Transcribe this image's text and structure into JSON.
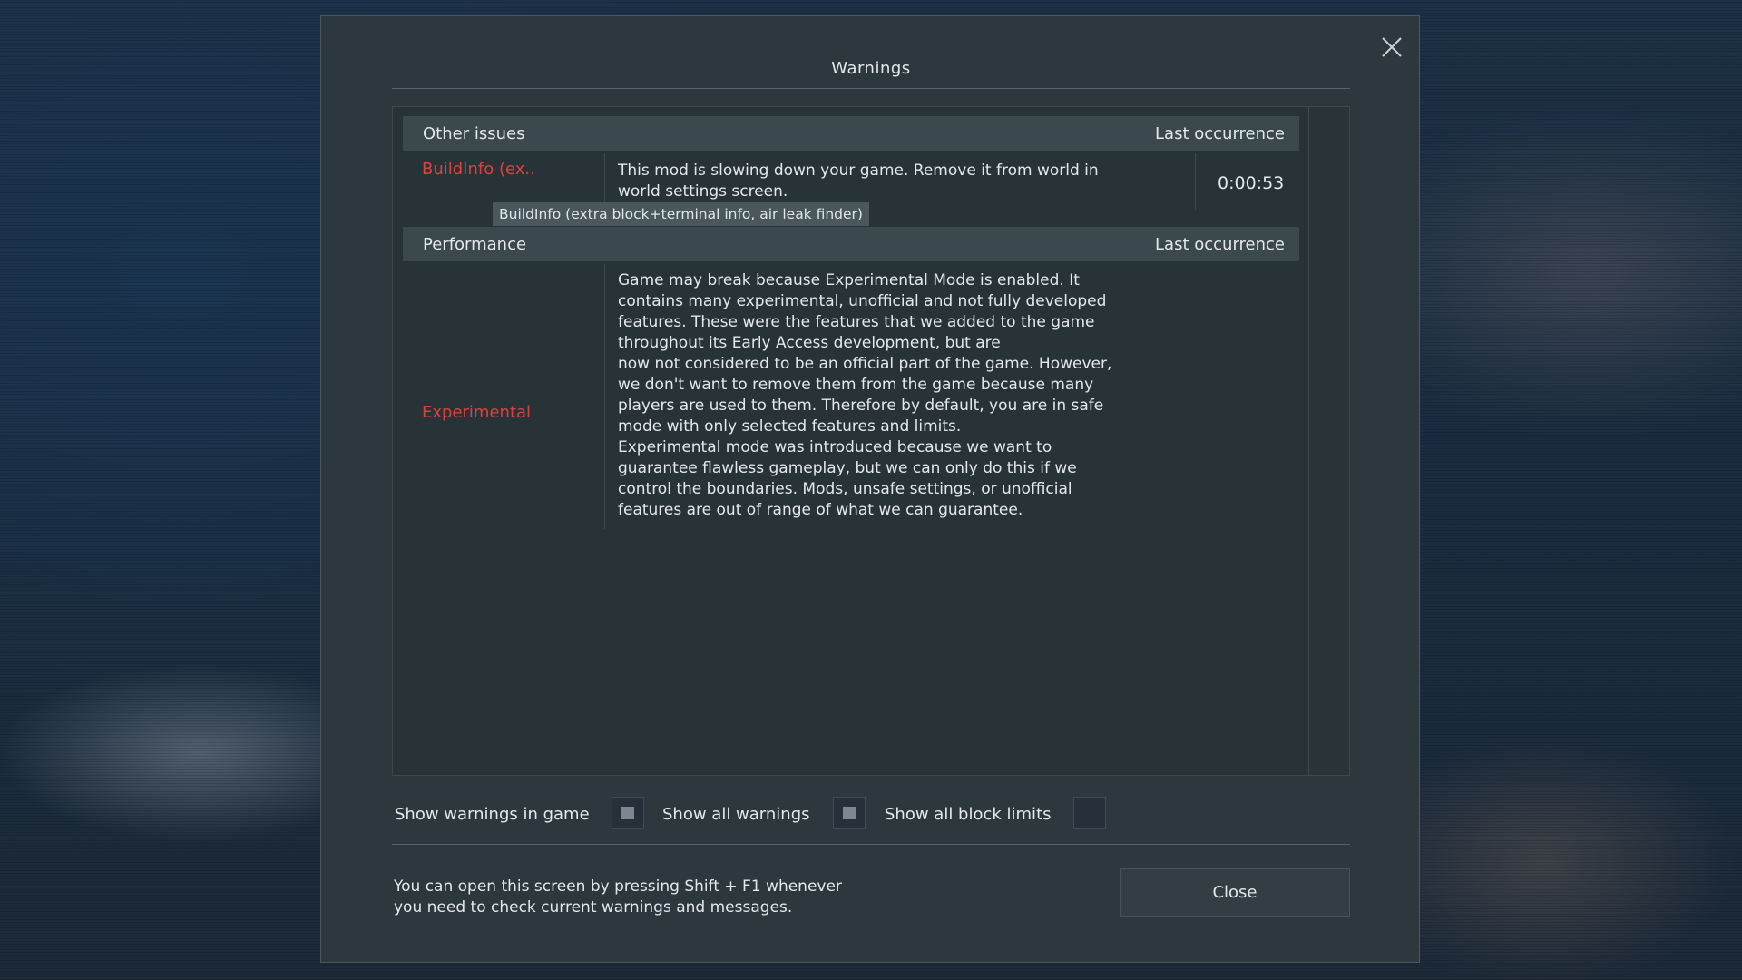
{
  "dialog": {
    "title": "Warnings",
    "close_icon": "close-icon"
  },
  "sections": [
    {
      "label": "Other issues",
      "right_label": "Last occurrence",
      "rows": [
        {
          "name": "BuildInfo (ex..",
          "description": "This mod is slowing down your game. Remove it from world in\nworld settings screen.",
          "time": "0:00:53",
          "tooltip": "BuildInfo (extra block+terminal info, air leak finder)"
        }
      ]
    },
    {
      "label": "Performance",
      "right_label": "Last occurrence",
      "rows": [
        {
          "name": "Experimental",
          "description": "Game may break because Experimental Mode is enabled. It\ncontains many experimental, unofficial and not fully developed\nfeatures. These were the features that we added to the game\nthroughout its Early Access development, but are\nnow not considered to be an official part of the game. However,\nwe don't want to remove them from the game because many\nplayers are used to them. Therefore by default, you are in safe\nmode with only selected features and limits.\nExperimental mode was introduced because we want to\nguarantee flawless gameplay, but we can only do this if we\ncontrol the boundaries. Mods, unsafe settings, or unofficial\nfeatures are out of range of what we can guarantee.",
          "time": ""
        }
      ]
    }
  ],
  "options": [
    {
      "label": "Show warnings in game",
      "checked": true
    },
    {
      "label": "Show all warnings",
      "checked": true
    },
    {
      "label": "Show all block limits",
      "checked": false
    }
  ],
  "footer": {
    "hint": "You can open this screen by pressing Shift + F1 whenever you need to check current warnings and messages.",
    "close_label": "Close"
  },
  "colors": {
    "error_text": "#e0403b",
    "dialog_bg": "#2c383e",
    "header_bg": "#3b484e"
  }
}
